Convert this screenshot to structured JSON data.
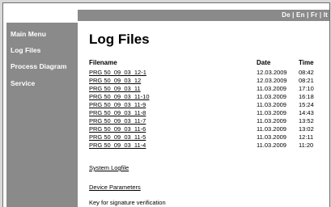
{
  "languages": [
    "De",
    "En",
    "Fr",
    "It"
  ],
  "sidebar": {
    "items": [
      "Main Menu",
      "Log Files",
      "Process Diagram",
      "Service"
    ]
  },
  "main": {
    "title": "Log Files",
    "columns": {
      "filename": "Filename",
      "date": "Date",
      "time": "Time"
    },
    "files": [
      {
        "name": "PRG 50_09_03_12-1",
        "date": "12.03.2009",
        "time": "08:42"
      },
      {
        "name": "PRG 50_09_03_12",
        "date": "12.03.2009",
        "time": "08:21"
      },
      {
        "name": "PRG 50_09_03_11",
        "date": "11.03.2009",
        "time": "17:10"
      },
      {
        "name": "PRG 50_09_03_11-10",
        "date": "11.03.2009",
        "time": "16:18"
      },
      {
        "name": "PRG 50_09_03_11-9",
        "date": "11.03.2009",
        "time": "15:24"
      },
      {
        "name": "PRG 50_09_03_11-8",
        "date": "11.03.2009",
        "time": "14:43"
      },
      {
        "name": "PRG 50_09_03_11-7",
        "date": "11.03.2009",
        "time": "13:52"
      },
      {
        "name": "PRG 50_09_03_11-6",
        "date": "11.03.2009",
        "time": "13:02"
      },
      {
        "name": "PRG 50_09_03_11-5",
        "date": "11.03.2009",
        "time": "12:11"
      },
      {
        "name": "PRG 50_09_03_11-4",
        "date": "11.03.2009",
        "time": "11:20"
      }
    ],
    "system_logfile": "System Logfile",
    "device_parameters": "Device Parameters",
    "signature_key": "Key for signature verification"
  }
}
